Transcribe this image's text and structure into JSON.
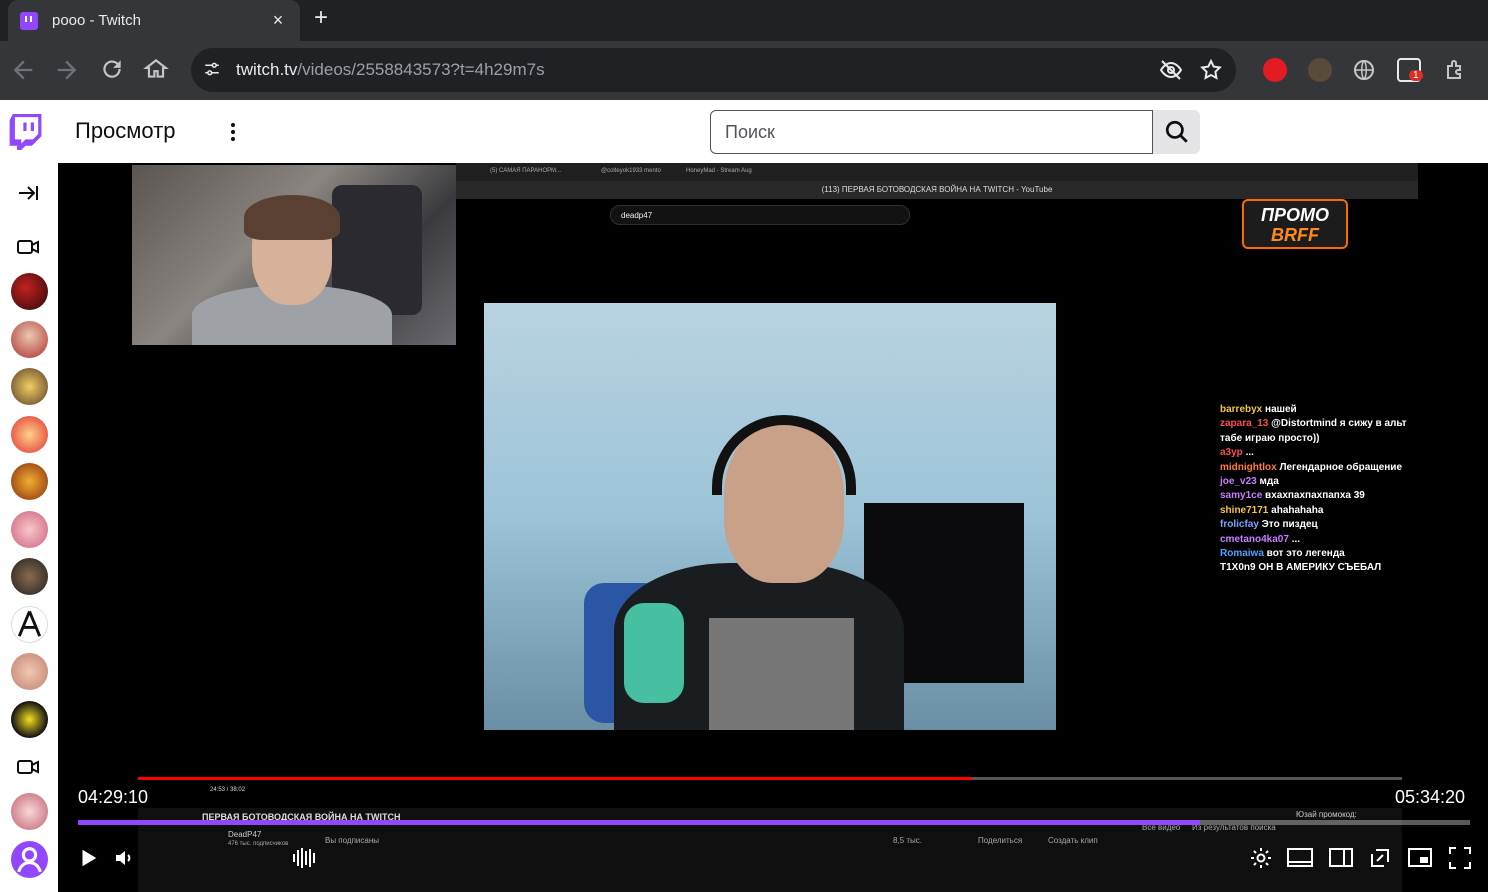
{
  "browser": {
    "tab_title": "pooo - Twitch",
    "tab_close": "×",
    "new_tab": "+",
    "url_host": "twitch.tv",
    "url_path": "/videos/2558843573?t=4h29m7s",
    "extension_badge": "1"
  },
  "twitch": {
    "browse_label": "Просмотр",
    "search_placeholder": "Поиск"
  },
  "stream": {
    "yt_tab_1": "(5) САМАЯ ПАРАНОРМ...",
    "yt_tab_2": "@colteyok1933 mento",
    "yt_tab_3": "HoneyMad - Stream Aug",
    "yt_window_title": "(113) ПЕРВАЯ БОТОВОДСКАЯ ВОЙНА НА TWITCH - YouTube",
    "yt_search_value": "deadp47",
    "promo_line1": "ПРОМО",
    "promo_line2": "BRFF",
    "yt_time": "24:53 / 38:02",
    "yt_video_title": "ПЕРВАЯ БОТОВОДСКАЯ ВОЙНА НА TWITCH",
    "yt_channel": "DeadP47",
    "yt_subs": "476 тыс. подписчиков",
    "yt_subscribed": "Вы подписаны",
    "yt_likes": "8,5 тыс.",
    "yt_share": "Поделиться",
    "yt_clip": "Создать клип",
    "yt_all_videos": "Все видео",
    "yt_search_results": "Из результатов поиска",
    "yt_promo_text": "Юзай промокод:",
    "chat": [
      {
        "user": "barrebyx",
        "color": "#f5c542",
        "msg": "нашей"
      },
      {
        "user": "zapara_13",
        "color": "#ff4d4d",
        "msg": "@Distortmind я сижу в альт табе играю просто))"
      },
      {
        "user": "a3yp",
        "color": "#ff4d4d",
        "msg": "..."
      },
      {
        "user": "midnightlox",
        "color": "#ff7a3d",
        "msg": "Легендарное обращение"
      },
      {
        "user": "joe_v23",
        "color": "#c77dff",
        "msg": "мда"
      },
      {
        "user": "samy1ce",
        "color": "#c77dff",
        "msg": "вхахпахпахпапха 39"
      },
      {
        "user": "shine7171",
        "color": "#f5c542",
        "msg": "ahahahaha"
      },
      {
        "user": "frolicfay",
        "color": "#7aa2ff",
        "msg": "Это пиздец"
      },
      {
        "user": "cmetano4ka07",
        "color": "#c77dff",
        "msg": "..."
      },
      {
        "user": "Romaiwa",
        "color": "#4da3ff",
        "msg": "вот это легенда"
      },
      {
        "user": "T1X0n9",
        "color": "#ffffff",
        "msg": "ОН В АМЕРИКУ СЪЕБАЛ"
      }
    ]
  },
  "player": {
    "current_time": "04:29:10",
    "total_time": "05:34:20",
    "progress_fraction": 0.806,
    "accent_color": "#9147ff"
  }
}
